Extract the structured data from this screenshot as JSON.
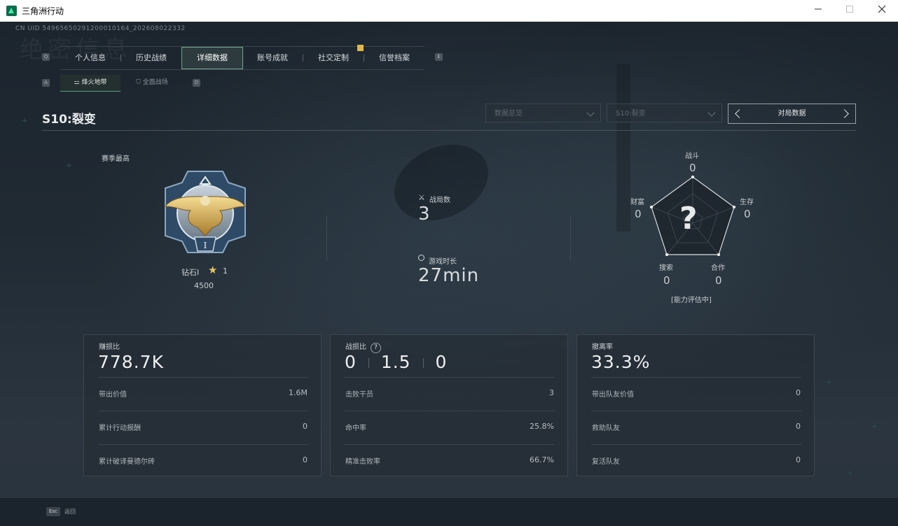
{
  "window": {
    "title": "三角洲行动",
    "minimize_icon": "minimize-icon",
    "maximize_icon": "maximize-icon",
    "close_icon": "close-icon"
  },
  "header": {
    "cnuid": "CN UID 54965650291200010164_202608022332",
    "watermark": "绝密信息"
  },
  "key_hints": {
    "left_tab": "Q",
    "right_tab": "E",
    "left_sub": "A",
    "right_sub": "D"
  },
  "tabs": [
    {
      "label": "个人信息"
    },
    {
      "label": "历史战绩"
    },
    {
      "label": "详细数据",
      "active": true
    },
    {
      "label": "账号成就"
    },
    {
      "label": "社交定制"
    },
    {
      "label": "信誉档案"
    }
  ],
  "subtabs": [
    {
      "label": "烽火地带",
      "icon": "flame-zone-icon",
      "active": true
    },
    {
      "label": "全面战场",
      "icon": "battlefield-icon"
    }
  ],
  "season": {
    "title": "S10:裂变"
  },
  "filters": {
    "data_overview": "数据总览",
    "season_select": "S10:裂变",
    "mode_switcher": "对局数据"
  },
  "rank": {
    "label": "赛季最高",
    "tier": "钻石I",
    "stars": "1",
    "points": "4500",
    "emblem_icon": "diamond-eagle-emblem-icon",
    "emblem_numeral": "I"
  },
  "summary": {
    "matches_label": "战局数",
    "matches_value": "3",
    "matches_icon": "crossed-swords-icon",
    "time_label": "游戏时长",
    "time_value": "27min",
    "time_icon": "clock-icon"
  },
  "radar": {
    "center": "?",
    "status": "[能力评估中]",
    "axes": [
      {
        "label": "战斗",
        "value": "0"
      },
      {
        "label": "生存",
        "value": "0"
      },
      {
        "label": "合作",
        "value": "0"
      },
      {
        "label": "搜索",
        "value": "0"
      },
      {
        "label": "财富",
        "value": "0"
      }
    ]
  },
  "cards": [
    {
      "label": "赚损比",
      "value": "778.7K",
      "rows": [
        {
          "label": "带出价值",
          "value": "1.6M"
        },
        {
          "label": "累计行动报酬",
          "value": "0"
        },
        {
          "label": "累计破译曼德尔砖",
          "value": "0"
        }
      ]
    },
    {
      "label": "战损比",
      "values": [
        "0",
        "1.5",
        "0"
      ],
      "help_icon": "?",
      "rows": [
        {
          "label": "击败干员",
          "value": "3"
        },
        {
          "label": "命中率",
          "value": "25.8%"
        },
        {
          "label": "精准击败率",
          "value": "66.7%"
        }
      ]
    },
    {
      "label": "撤离率",
      "value": "33.3%",
      "rows": [
        {
          "label": "带出队友价值",
          "value": "0"
        },
        {
          "label": "救助队友",
          "value": "0"
        },
        {
          "label": "复活队友",
          "value": "0"
        }
      ]
    }
  ],
  "footer": {
    "esc_key": "Esc",
    "back_label": "返回"
  }
}
